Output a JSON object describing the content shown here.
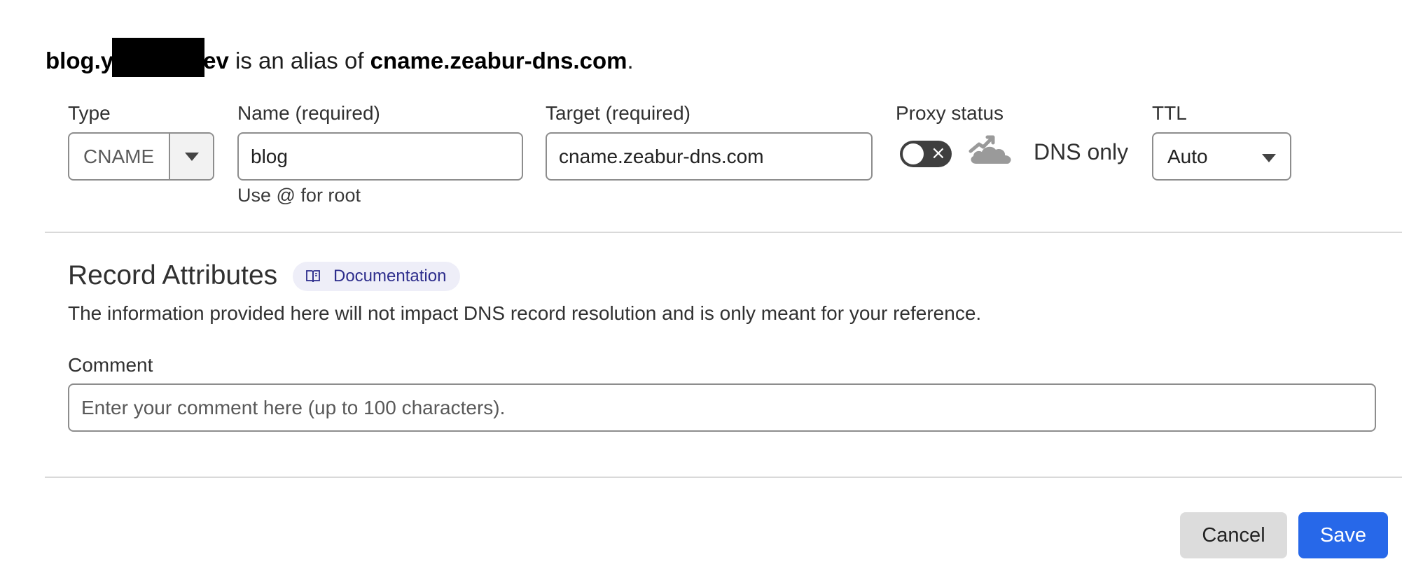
{
  "alias": {
    "host_prefix": "blog.y",
    "host_suffix": "ev",
    "middle": " is an alias of ",
    "target": "cname.zeabur-dns.com",
    "end": "."
  },
  "form": {
    "type": {
      "label": "Type",
      "value": "CNAME"
    },
    "name": {
      "label": "Name (required)",
      "value": "blog",
      "hint": "Use @ for root"
    },
    "target": {
      "label": "Target (required)",
      "value": "cname.zeabur-dns.com"
    },
    "proxy": {
      "label": "Proxy status",
      "enabled": false,
      "status_text": "DNS only",
      "cloud_icon": "cloud-bypass-icon",
      "cloud_color": "#9a9a9a"
    },
    "ttl": {
      "label": "TTL",
      "value": "Auto"
    }
  },
  "attributes": {
    "title": "Record Attributes",
    "doc_label": "Documentation",
    "doc_icon": "book-icon",
    "description": "The information provided here will not impact DNS record resolution and is only meant for your reference.",
    "comment_label": "Comment",
    "comment_placeholder": "Enter your comment here (up to 100 characters).",
    "comment_value": ""
  },
  "actions": {
    "cancel": "Cancel",
    "save": "Save"
  },
  "colors": {
    "primary": "#2768e9",
    "doc_badge_bg": "#eeeef8",
    "doc_badge_text": "#2d2d8c",
    "toggle_off": "#3f3f3f"
  }
}
